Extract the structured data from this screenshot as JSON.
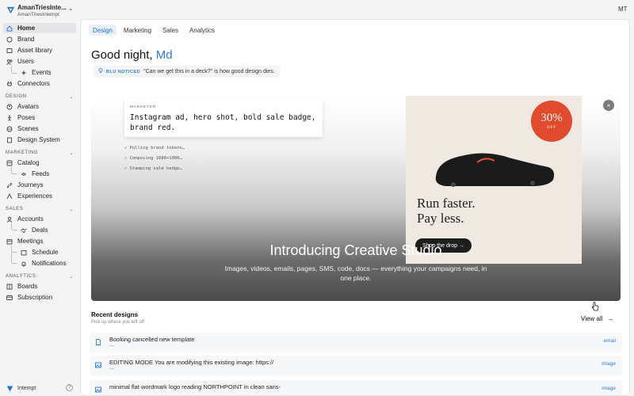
{
  "workspace": {
    "name": "AmanTriesInte...",
    "subtitle": "AmanTriesIntempt"
  },
  "nav": {
    "home": "Home",
    "brand": "Brand",
    "asset_library": "Asset library",
    "users": "Users",
    "events": "Events",
    "connectors": "Connectors",
    "design_header": "DESIGN",
    "avatars": "Avatars",
    "poses": "Poses",
    "scenes": "Scenes",
    "design_system": "Design System",
    "marketing_header": "MARKETING",
    "catalog": "Catalog",
    "feeds": "Feeds",
    "journeys": "Journeys",
    "experiences": "Experiences",
    "sales_header": "SALES",
    "accounts": "Accounts",
    "deals": "Deals",
    "meetings": "Meetings",
    "schedule": "Schedule",
    "notifications": "Notifications",
    "analytics_header": "ANALYTICS",
    "boards": "Boards",
    "subscription": "Subscription"
  },
  "footer": {
    "label": "Intempt",
    "help": "?"
  },
  "user": {
    "initials": "MT"
  },
  "tabs": [
    "Design",
    "Marketing",
    "Sales",
    "Analytics"
  ],
  "greeting": {
    "text": "Good night,",
    "name": "Md"
  },
  "notice": {
    "tag": "BLU NOTICED",
    "quote": "\"Can we get this in a deck?\" is how good design dies."
  },
  "hero": {
    "prompt_tag": "MARKETER",
    "prompt_text": "Instagram ad, hero shot, bold sale badge, brand red.",
    "steps": [
      "✓ Pulling brand tokens…",
      "✓ Composing 1080×1080…",
      "✓ Stamping sale badge…"
    ],
    "badge_pct": "30%",
    "badge_off": "OFF",
    "ad_line1": "Run faster.",
    "ad_line2": "Pay less.",
    "ad_button": "Shop the drop →",
    "close": "×",
    "title": "Introducing Creative Studio",
    "subtitle": "Images, videos, emails, pages, SMS, code, docs — everything your campaigns need, in one place."
  },
  "recent": {
    "title": "Recent designs",
    "subtitle": "Pick up where you left off",
    "view_all": "View all",
    "items": [
      {
        "title": "Booking cancelled new template",
        "sub": "—",
        "type": "email",
        "icon": "doc-icon"
      },
      {
        "title": "EDITING MODE You are modifying this existing image: https://",
        "sub": "—",
        "type": "image",
        "icon": "image-icon"
      },
      {
        "title": "minimal flat wordmark logo reading NORTHPOINT in clean sans-",
        "sub": "",
        "type": "image",
        "icon": "image-icon"
      }
    ]
  },
  "colors": {
    "accent": "#2b7de9",
    "badge": "#e24a2e",
    "active_tab_bg": "#e8f1fb"
  }
}
